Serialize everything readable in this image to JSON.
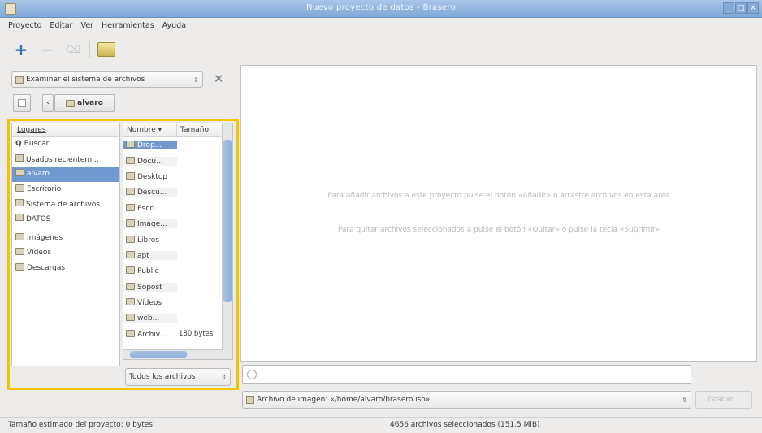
{
  "window": {
    "title": "Nuevo proyecto de datos - Brasero",
    "controls": [
      "_",
      "□",
      "×"
    ]
  },
  "menu": [
    "Proyecto",
    "Editar",
    "Ver",
    "Herramientas",
    "Ayuda"
  ],
  "toolbar": {
    "add": "+",
    "remove": "−",
    "clear": "⌫"
  },
  "explorer": {
    "combo_label": "Examinar el sistema de archivos",
    "combo_arrows": "⇕",
    "close_glyph": "✕",
    "path_button": "alvaro"
  },
  "places": {
    "header": "Lugares",
    "items": [
      "Buscar",
      "Usados recientem...",
      "alvaro",
      "Escritorio",
      "Sistema de archivos",
      "DATOS",
      "Imágenes",
      "Vídeos",
      "Descargas"
    ],
    "selected_index": 2
  },
  "files": {
    "name_header": "Nombre",
    "sort_glyph": "▾",
    "size_header": "Tamaño",
    "rows": [
      {
        "name": "Drop...",
        "size": ""
      },
      {
        "name": "Docu...",
        "size": ""
      },
      {
        "name": "Desktop",
        "size": ""
      },
      {
        "name": "Descu...",
        "size": ""
      },
      {
        "name": "Escri...",
        "size": ""
      },
      {
        "name": "Imáge...",
        "size": ""
      },
      {
        "name": "Libros",
        "size": ""
      },
      {
        "name": "apt",
        "size": ""
      },
      {
        "name": "Public",
        "size": ""
      },
      {
        "name": "Sopost",
        "size": ""
      },
      {
        "name": "Vídeos",
        "size": ""
      },
      {
        "name": "web...",
        "size": ""
      },
      {
        "name": "Archiv...",
        "size": "180 bytes"
      }
    ],
    "selected_index": 0,
    "filter": "Todos los archivos",
    "filter_arrows": "⇕"
  },
  "project": {
    "hint1": "Para añadir archivos a este proyecto pulse el botón «Añadir» o arrastre archivos en esta área",
    "hint2": "Para quitar archivos seleccionados a pulse el botón «Quitar» o pulse la tecla «Suprimir»"
  },
  "destination": {
    "label": "Archivo de imagen: «/home/alvaro/brasero.iso»",
    "arrows": "⇕",
    "burn_label": "Grabar..."
  },
  "status": {
    "left": "Tamaño estimado del proyecto: 0 bytes",
    "center": "4656 archivos seleccionados (151,5 MiB)"
  }
}
